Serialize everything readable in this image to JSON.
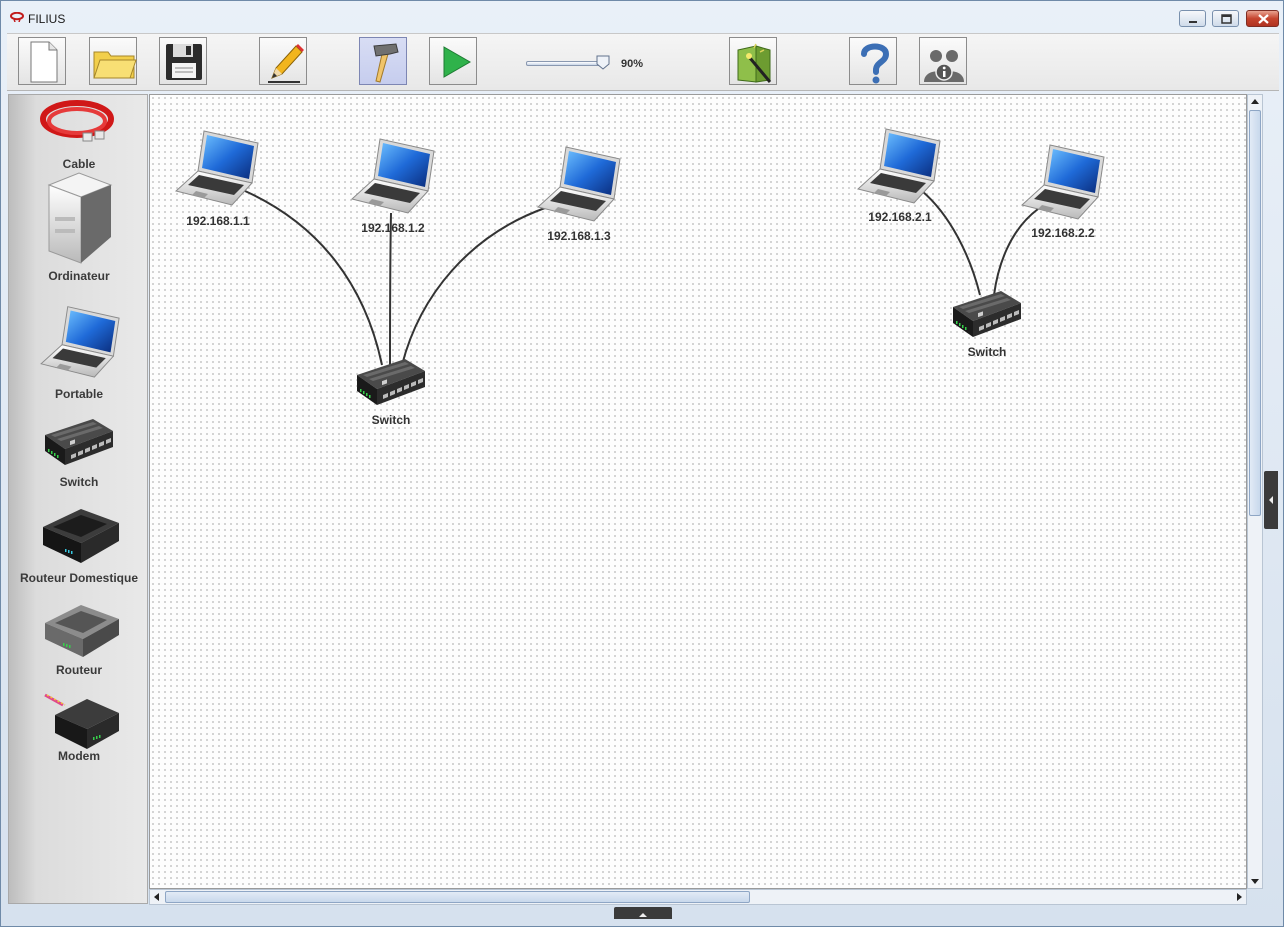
{
  "window": {
    "title": "FILIUS"
  },
  "toolbar": {
    "buttons": [
      {
        "name": "new",
        "icon": "new-file-icon"
      },
      {
        "name": "open",
        "icon": "folder-icon"
      },
      {
        "name": "save",
        "icon": "floppy-icon"
      },
      {
        "name": "design-mode",
        "icon": "pencil-icon"
      },
      {
        "name": "build-mode",
        "icon": "hammer-icon",
        "active": true
      },
      {
        "name": "simulate",
        "icon": "play-icon"
      },
      {
        "name": "wizard",
        "icon": "book-wand-icon"
      },
      {
        "name": "help",
        "icon": "question-icon"
      },
      {
        "name": "about",
        "icon": "users-info-icon"
      }
    ],
    "zoom": {
      "value": 0.9,
      "label": "90%"
    }
  },
  "palette": {
    "items": [
      {
        "label": "Cable",
        "icon": "cable-icon"
      },
      {
        "label": "Ordinateur",
        "icon": "computer-icon"
      },
      {
        "label": "Portable",
        "icon": "laptop-icon"
      },
      {
        "label": "Switch",
        "icon": "switch-icon"
      },
      {
        "label": "Routeur Domestique",
        "icon": "home-router-icon"
      },
      {
        "label": "Routeur",
        "icon": "router-icon"
      },
      {
        "label": "Modem",
        "icon": "modem-icon"
      }
    ]
  },
  "network": {
    "nodes": [
      {
        "id": "laptop-1",
        "type": "laptop",
        "label": "192.168.1.1"
      },
      {
        "id": "laptop-2",
        "type": "laptop",
        "label": "192.168.1.2"
      },
      {
        "id": "laptop-3",
        "type": "laptop",
        "label": "192.168.1.3"
      },
      {
        "id": "switch-1",
        "type": "switch",
        "label": "Switch"
      },
      {
        "id": "laptop-4",
        "type": "laptop",
        "label": "192.168.2.1"
      },
      {
        "id": "laptop-5",
        "type": "laptop",
        "label": "192.168.2.2"
      },
      {
        "id": "switch-2",
        "type": "switch",
        "label": "Switch"
      }
    ],
    "cables": [
      {
        "from": "laptop-1",
        "to": "switch-1"
      },
      {
        "from": "laptop-2",
        "to": "switch-1"
      },
      {
        "from": "laptop-3",
        "to": "switch-1"
      },
      {
        "from": "laptop-4",
        "to": "switch-2"
      },
      {
        "from": "laptop-5",
        "to": "switch-2"
      }
    ]
  },
  "colors": {
    "cable": "#333333",
    "accent_active": "#c6cdee",
    "window_frame": "#6f8aa8"
  }
}
